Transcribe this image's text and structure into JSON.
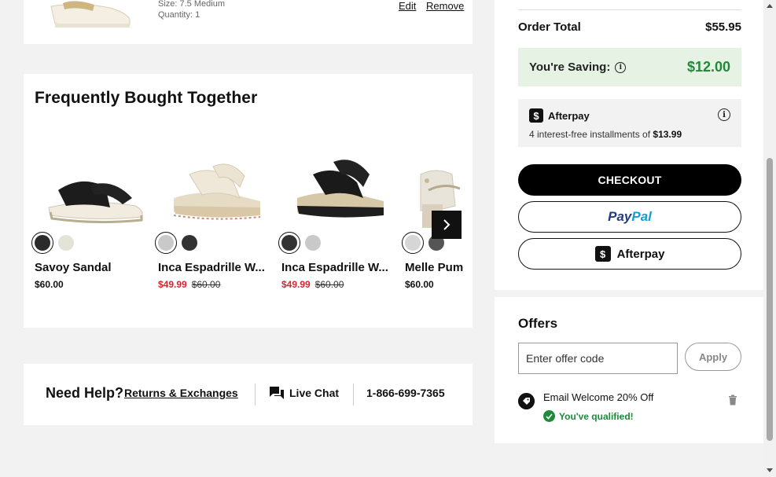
{
  "cart_item": {
    "size": "Size: 7.5 Medium",
    "quantity": "Quantity: 1",
    "edit_label": "Edit",
    "remove_label": "Remove"
  },
  "fbt": {
    "title": "Frequently Bought Together",
    "products": [
      {
        "name": "Savoy Sandal",
        "price": "$60.00",
        "sale_price": "",
        "original_price": "",
        "swatches": [
          "#2b2b2b",
          "#e3e3d8"
        ],
        "icon": "black-strappy-sandal"
      },
      {
        "name": "Inca Espadrille W...",
        "price": "",
        "sale_price": "$49.99",
        "original_price": "$60.00",
        "swatches": [
          "#c9c9c9",
          "#333333"
        ],
        "icon": "cream-wedge-sandal"
      },
      {
        "name": "Inca Espadrille W...",
        "price": "",
        "sale_price": "$49.99",
        "original_price": "$60.00",
        "swatches": [
          "#333333",
          "#c9c9c9"
        ],
        "icon": "black-wedge-sandal"
      },
      {
        "name": "Melle Pum",
        "price": "$60.00",
        "sale_price": "",
        "original_price": "",
        "swatches": [
          "#d6d6d6",
          "#555555"
        ],
        "icon": "beige-block-heel-sandal"
      }
    ],
    "next_icon": "chevron-right-icon"
  },
  "help": {
    "title": "Need Help?",
    "returns_label": "Returns & Exchanges",
    "chat_label": "Live Chat",
    "phone": "1-866-699-7365"
  },
  "summary": {
    "order_total_label": "Order Total",
    "order_total_value": "$55.95",
    "saving_label": "You're Saving:",
    "saving_value": "$12.00",
    "afterpay_name": "Afterpay",
    "afterpay_text_prefix": "4 interest-free installments of",
    "afterpay_installment": "$13.99",
    "checkout_label": "CHECKOUT",
    "paypal_part1": "Pay",
    "paypal_part2": "Pal",
    "afterpay_button_label": "Afterpay",
    "colors": {
      "saving_green": "#1f8a3a",
      "saving_bg": "#e6f3e4",
      "sale_red": "#d6262f"
    }
  },
  "offers": {
    "title": "Offers",
    "input_placeholder": "Enter offer code",
    "apply_label": "Apply",
    "offer_name": "Email Welcome 20% Off",
    "qualified_text": "You've qualified!"
  }
}
